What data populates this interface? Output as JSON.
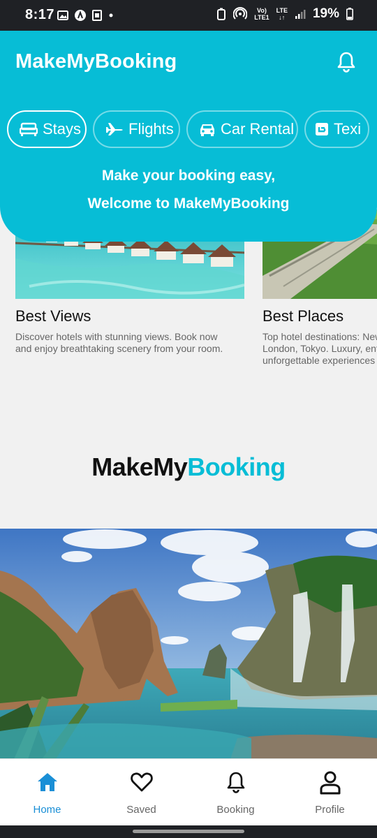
{
  "status_bar": {
    "time": "8:17",
    "battery": "19%",
    "network_top": "Vo)",
    "network_bottom": "LTE1",
    "lte": "LTE"
  },
  "header": {
    "title": "MakeMyBooking",
    "welcome_line1": "Make your booking easy,",
    "welcome_line2": "Welcome to MakeMyBooking",
    "color": "#07bdd6"
  },
  "tabs": [
    {
      "label": "Stays",
      "icon": "bed-icon",
      "active": true
    },
    {
      "label": "Flights",
      "icon": "airplane-icon",
      "active": false
    },
    {
      "label": "Car Rental",
      "icon": "car-icon",
      "active": false
    },
    {
      "label": "Texi",
      "icon": "taxi-icon",
      "active": false
    }
  ],
  "cards": [
    {
      "title": "Best Views",
      "description": "Discover hotels with stunning views. Book now and enjoy breathtaking scenery from your room."
    },
    {
      "title": "Best Places",
      "description": "Top hotel destinations: New York, Paris, Dubai, London, Tokyo. Luxury, entertainment, and unforgettable experiences await"
    }
  ],
  "brand": {
    "part1": "MakeMy",
    "part2": "Booking"
  },
  "bottom_nav": [
    {
      "label": "Home",
      "icon": "home-icon",
      "active": true
    },
    {
      "label": "Saved",
      "icon": "heart-icon",
      "active": false
    },
    {
      "label": "Booking",
      "icon": "bell-icon",
      "active": false
    },
    {
      "label": "Profile",
      "icon": "person-icon",
      "active": false
    }
  ],
  "colors": {
    "accent": "#07bdd6",
    "nav_active": "#1a8fd6"
  }
}
